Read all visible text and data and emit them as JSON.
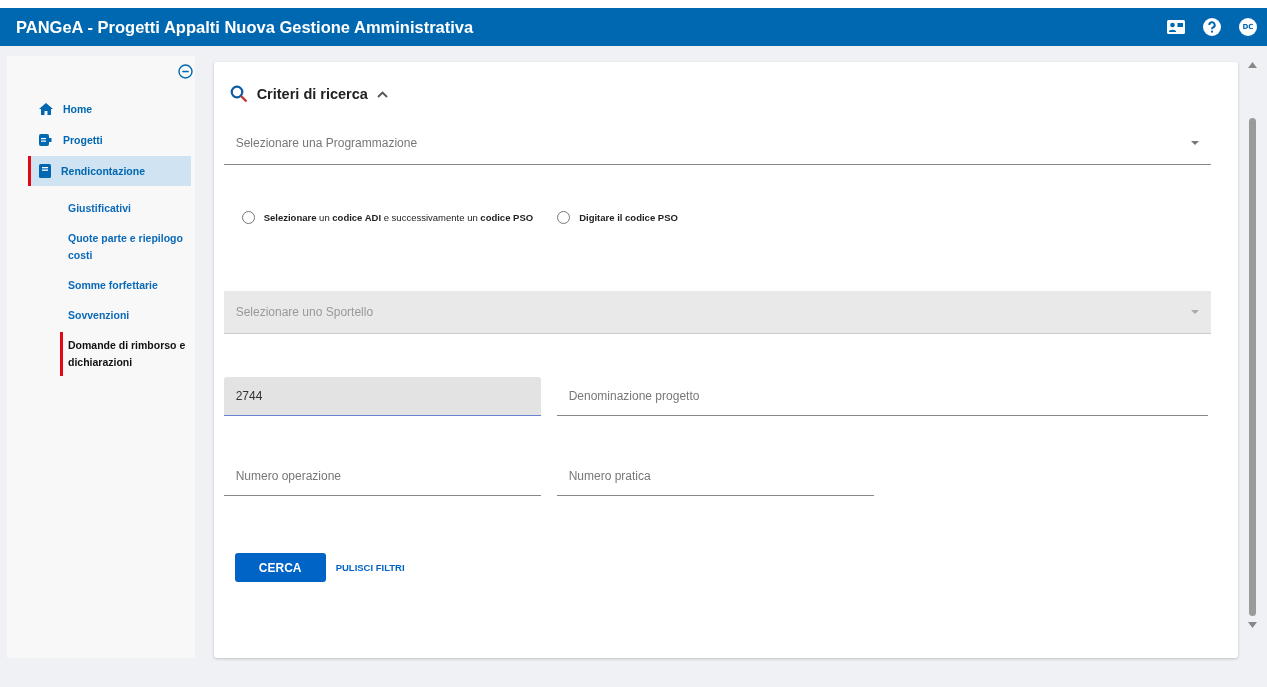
{
  "app_bar": {
    "title": "PANGeA - Progetti Appalti Nuova Gestione Amministrativa",
    "avatar": "DC"
  },
  "sidebar": {
    "items": [
      {
        "label": "Home",
        "selected": false
      },
      {
        "label": "Progetti",
        "selected": false
      },
      {
        "label": "Rendicontazione",
        "selected": true,
        "children": [
          {
            "label": "Giustificativi",
            "selected": false
          },
          {
            "label": "Quote parte e riepilogo costi",
            "selected": false
          },
          {
            "label": "Somme forfettarie",
            "selected": false
          },
          {
            "label": "Sovvenzioni",
            "selected": false
          },
          {
            "label": "Domande di rimborso e dichiarazioni",
            "selected": true
          }
        ]
      }
    ]
  },
  "search_panel": {
    "title": "Criteri di ricerca",
    "expanded": true,
    "programmazione": {
      "kind": "select",
      "placeholder": "Selezionare una Programmazione",
      "disabled": false
    },
    "radio_options": [
      {
        "label": "**Selezionare** un **codice ADI** e successivamente un **codice PSO**",
        "selected": false
      },
      {
        "label": "Digitare il codice PSO",
        "selected": false
      }
    ],
    "sportello": {
      "kind": "select",
      "placeholder": "Selezionare uno Sportello",
      "disabled": true
    },
    "field_rows": [
      [
        {
          "kind": "text",
          "value": "2744",
          "disabled": true
        },
        {
          "kind": "text",
          "placeholder": "Denominazione progetto",
          "disabled": false
        }
      ],
      [
        {
          "kind": "text",
          "placeholder": "Numero operazione",
          "disabled": false
        },
        {
          "kind": "text",
          "placeholder": "Numero pratica",
          "disabled": false
        }
      ]
    ],
    "buttons": [
      {
        "label": "CERCA",
        "kind": "primary"
      },
      {
        "label": "PULISCI FILTRI",
        "kind": "text"
      }
    ]
  }
}
